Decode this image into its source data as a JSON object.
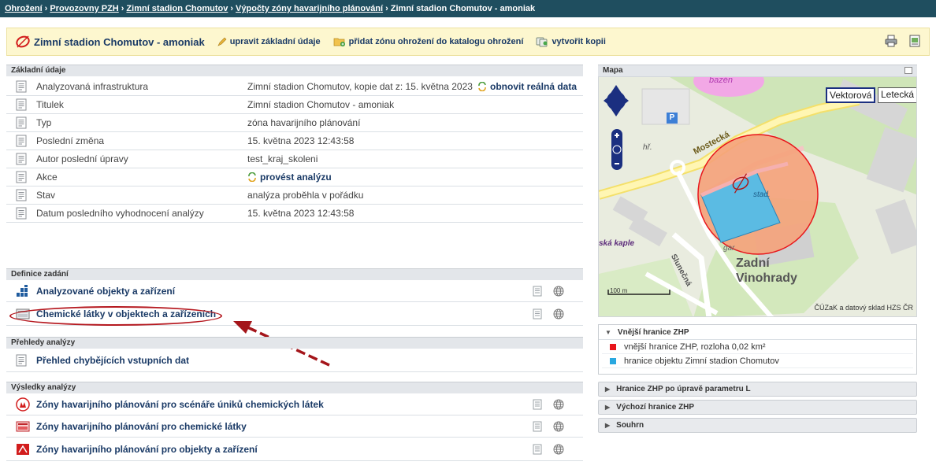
{
  "breadcrumb": {
    "items": [
      "Ohrožení",
      "Provozovny PZH",
      "Zimní stadion Chomutov",
      "Výpočty zóny havarijního plánování"
    ],
    "current": "Zimní stadion Chomutov - amoniak",
    "separator": "›"
  },
  "toolbar": {
    "title": "Zimní stadion Chomutov - amoniak",
    "edit_label": "upravit základní údaje",
    "add_zone_label": "přidat zónu ohrožení do katalogu ohrožení",
    "copy_label": "vytvořit kopii"
  },
  "basic": {
    "header": "Základní údaje",
    "rows": [
      {
        "label": "Analyzovaná infrastruktura",
        "value": "Zimní stadion Chomutov, kopie dat z: 15. května 2023",
        "action": "obnovit reálná data"
      },
      {
        "label": "Titulek",
        "value": "Zimní stadion Chomutov - amoniak"
      },
      {
        "label": "Typ",
        "value": "zóna havarijního plánování"
      },
      {
        "label": "Poslední změna",
        "value": "15. května 2023 12:43:58"
      },
      {
        "label": "Autor poslední úpravy",
        "value": "test_kraj_skoleni"
      },
      {
        "label": "Akce",
        "value": "provést analýzu"
      },
      {
        "label": "Stav",
        "value": "analýza proběhla v pořádku"
      },
      {
        "label": "Datum posledního vyhodnocení analýzy",
        "value": "15. května 2023 12:43:58"
      }
    ]
  },
  "definition": {
    "header": "Definice zadání",
    "items": [
      "Analyzované objekty a zařízení",
      "Chemické látky v objektech a zařízeních"
    ]
  },
  "overview": {
    "header": "Přehledy analýzy",
    "items": [
      "Přehled chybějících vstupních dat"
    ]
  },
  "results": {
    "header": "Výsledky analýzy",
    "items": [
      "Zóny havarijního plánování pro scénáře úniků chemických látek",
      "Zóny havarijního plánování pro chemické látky",
      "Zóny havarijního plánování pro objekty a zařízení"
    ]
  },
  "map": {
    "header": "Mapa",
    "layer_vector": "Vektorová",
    "layer_aerial": "Letecká",
    "credit": "ČÚZaK a datový sklad HZS ČR",
    "scale_label": "100 m",
    "labels": {
      "pool": "bazén",
      "street1": "Mostecká",
      "stadium": "stad.",
      "district1": "Zadní",
      "district2": "Vinohrady",
      "chapel": "ská kaple",
      "street2": "Slunečná",
      "garage": "gar.",
      "hr": "hř.",
      "p": "P"
    }
  },
  "legend": {
    "header": "Vnější hranice ZHP",
    "item1": "vnější hranice ZHP, rozloha 0,02 km²",
    "item2": "hranice objektu Zimní stadion Chomutov",
    "color1": "#e8151b",
    "color2": "#29a8e0"
  },
  "panels": {
    "p1": "Hranice ZHP po úpravě parametru L",
    "p2": "Výchozí hranice ZHP",
    "p3": "Souhrn"
  }
}
